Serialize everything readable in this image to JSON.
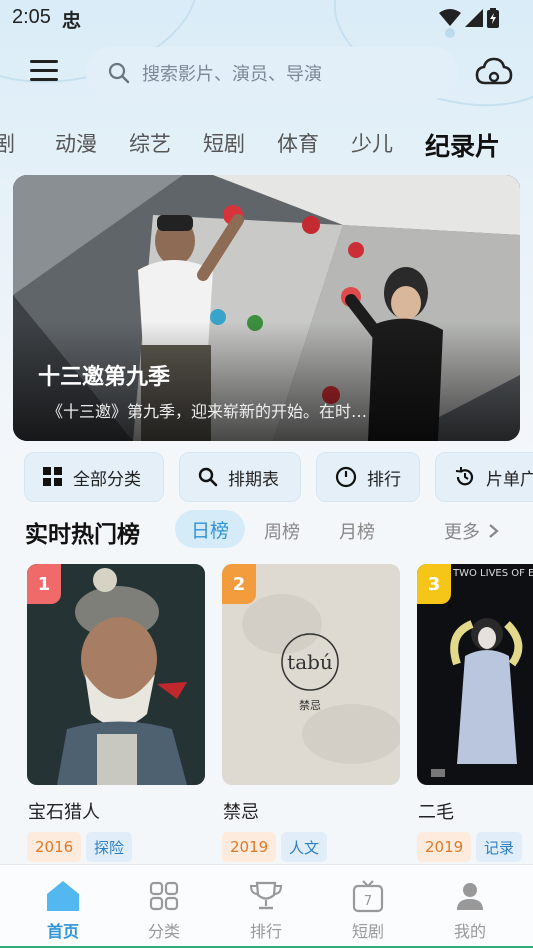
{
  "status": {
    "time": "2:05",
    "indicator": "忠"
  },
  "search": {
    "placeholder": "搜索影片、演员、导演"
  },
  "category_tabs": [
    "剧",
    "动漫",
    "综艺",
    "短剧",
    "体育",
    "少儿",
    "纪录片"
  ],
  "active_category": "纪录片",
  "banner": {
    "title": "十三邀第九季",
    "description": "《十三邀》第九季，迎来崭新的开始。在时…"
  },
  "shortcuts": [
    {
      "label": "全部分类",
      "icon": "grid-icon"
    },
    {
      "label": "排期表",
      "icon": "search-icon"
    },
    {
      "label": "排行",
      "icon": "clock-icon"
    },
    {
      "label": "片单广",
      "icon": "history-icon"
    }
  ],
  "hot_list": {
    "title": "实时热门榜",
    "tabs": [
      "日榜",
      "周榜",
      "月榜"
    ],
    "active_tab": "日榜",
    "more_label": "更多"
  },
  "cards": [
    {
      "rank": "1",
      "title": "宝石猎人",
      "year": "2016",
      "genre": "探险",
      "badge_color": "#f06a6a"
    },
    {
      "rank": "2",
      "title": "禁忌",
      "year": "2019",
      "genre": "人文",
      "badge_color": "#f39c3d",
      "poster_text_main": "tabú",
      "poster_text_sub": "禁忌"
    },
    {
      "rank": "3",
      "title": "二毛",
      "year": "2019",
      "genre": "记录",
      "badge_color": "#f5c518",
      "poster_text_main": "TWO LIVES OF E"
    }
  ],
  "bottom_nav": [
    {
      "label": "首页",
      "icon": "home-icon",
      "active": true
    },
    {
      "label": "分类",
      "icon": "category-icon",
      "active": false
    },
    {
      "label": "排行",
      "icon": "trophy-icon",
      "active": false
    },
    {
      "label": "短剧",
      "icon": "tv-icon",
      "active": false
    },
    {
      "label": "我的",
      "icon": "user-icon",
      "active": false
    }
  ],
  "colors": {
    "accent": "#2f93d8",
    "year_tag": "#e07a2a",
    "genre_tag": "#2f7fc4"
  }
}
